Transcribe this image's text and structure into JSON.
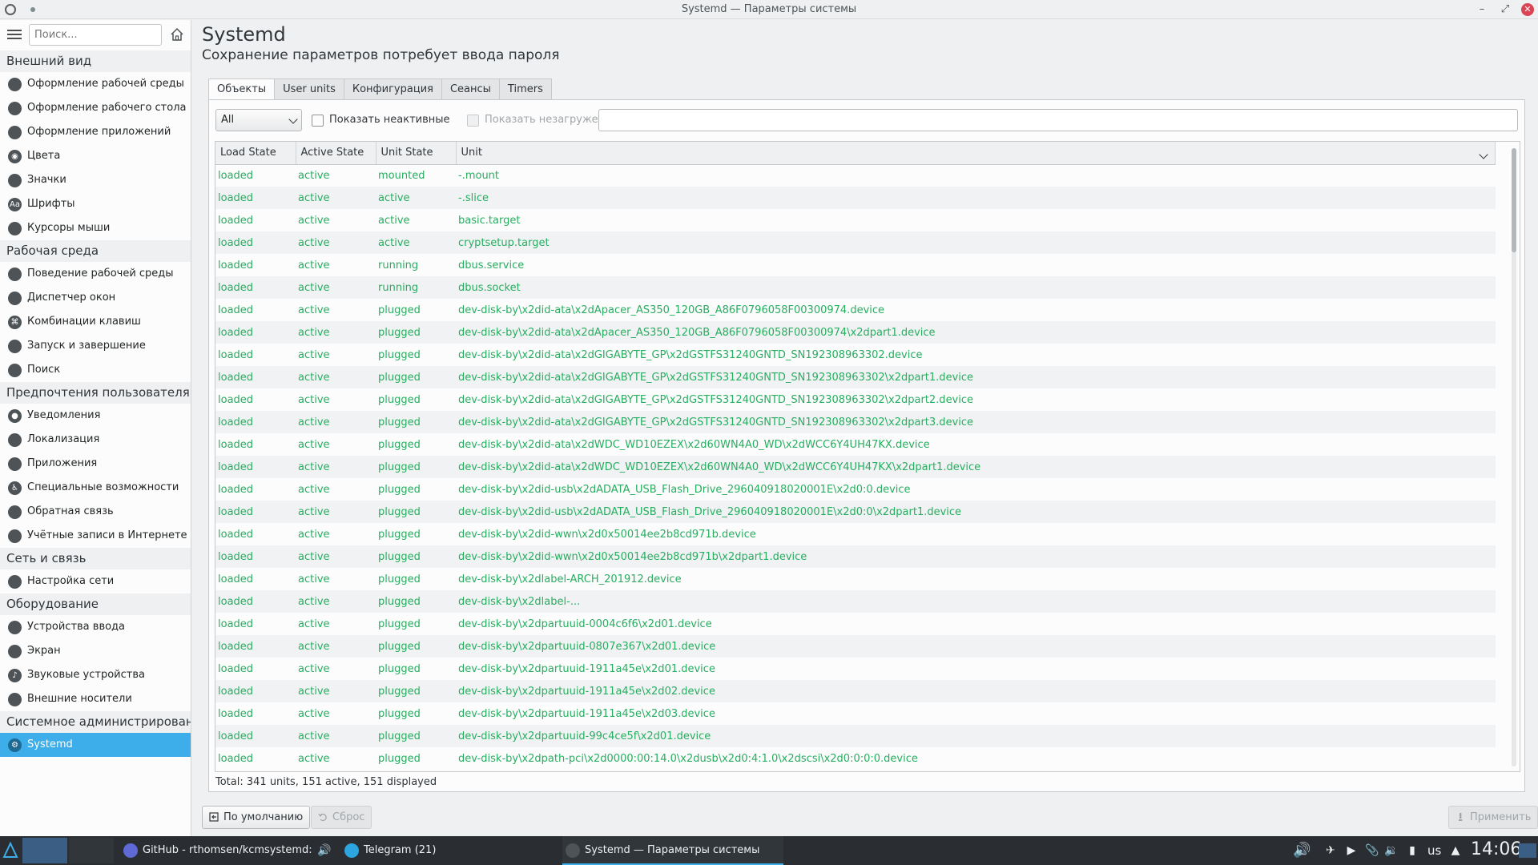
{
  "window": {
    "title": "Systemd — Параметры системы"
  },
  "sidebar": {
    "search_placeholder": "Поиск...",
    "categories": [
      {
        "title": "Внешний вид",
        "items": [
          {
            "label": "Оформление рабочей среды",
            "icon": "workspace-theme-icon"
          },
          {
            "label": "Оформление рабочего стола",
            "icon": "desktop-theme-icon"
          },
          {
            "label": "Оформление приложений",
            "icon": "application-style-icon"
          },
          {
            "label": "Цвета",
            "icon": "colors-icon"
          },
          {
            "label": "Значки",
            "icon": "icons-icon"
          },
          {
            "label": "Шрифты",
            "icon": "fonts-icon"
          },
          {
            "label": "Курсоры мыши",
            "icon": "cursor-icon"
          }
        ]
      },
      {
        "title": "Рабочая среда",
        "items": [
          {
            "label": "Поведение рабочей среды",
            "icon": "workspace-behavior-icon"
          },
          {
            "label": "Диспетчер окон",
            "icon": "window-manager-icon"
          },
          {
            "label": "Комбинации клавиш",
            "icon": "shortcuts-icon"
          },
          {
            "label": "Запуск и завершение",
            "icon": "startup-icon"
          },
          {
            "label": "Поиск",
            "icon": "search-icon"
          }
        ]
      },
      {
        "title": "Предпочтения пользователя",
        "items": [
          {
            "label": "Уведомления",
            "icon": "notifications-icon"
          },
          {
            "label": "Локализация",
            "icon": "locale-icon"
          },
          {
            "label": "Приложения",
            "icon": "applications-icon"
          },
          {
            "label": "Специальные возможности",
            "icon": "accessibility-icon"
          },
          {
            "label": "Обратная связь",
            "icon": "feedback-icon"
          },
          {
            "label": "Учётные записи в Интернете",
            "icon": "online-accounts-icon"
          }
        ]
      },
      {
        "title": "Сеть и связь",
        "items": [
          {
            "label": "Настройка сети",
            "icon": "network-icon"
          }
        ]
      },
      {
        "title": "Оборудование",
        "items": [
          {
            "label": "Устройства ввода",
            "icon": "input-devices-icon"
          },
          {
            "label": "Экран",
            "icon": "display-icon"
          },
          {
            "label": "Звуковые устройства",
            "icon": "audio-icon"
          },
          {
            "label": "Внешние носители",
            "icon": "removable-storage-icon"
          }
        ]
      },
      {
        "title": "Системное администрировани",
        "items": [
          {
            "label": "Systemd",
            "icon": "systemd-icon",
            "selected": true
          }
        ]
      }
    ]
  },
  "main": {
    "title": "Systemd",
    "subtitle": "Сохранение параметров потребует ввода пароля",
    "tabs": [
      "Объекты",
      "User units",
      "Конфигурация",
      "Сеансы",
      "Timers"
    ],
    "active_tab": 0,
    "filter_combo": "All",
    "show_inactive_label": "Показать неактивные",
    "show_unloaded_label": "Показать незагруженные",
    "columns": [
      "Load State",
      "Active State",
      "Unit State",
      "Unit"
    ],
    "rows": [
      [
        "loaded",
        "active",
        "mounted",
        "-.mount"
      ],
      [
        "loaded",
        "active",
        "active",
        "-.slice"
      ],
      [
        "loaded",
        "active",
        "active",
        "basic.target"
      ],
      [
        "loaded",
        "active",
        "active",
        "cryptsetup.target"
      ],
      [
        "loaded",
        "active",
        "running",
        "dbus.service"
      ],
      [
        "loaded",
        "active",
        "running",
        "dbus.socket"
      ],
      [
        "loaded",
        "active",
        "plugged",
        "dev-disk-by\\x2did-ata\\x2dApacer_AS350_120GB_A86F0796058F00300974.device"
      ],
      [
        "loaded",
        "active",
        "plugged",
        "dev-disk-by\\x2did-ata\\x2dApacer_AS350_120GB_A86F0796058F00300974\\x2dpart1.device"
      ],
      [
        "loaded",
        "active",
        "plugged",
        "dev-disk-by\\x2did-ata\\x2dGIGABYTE_GP\\x2dGSTFS31240GNTD_SN192308963302.device"
      ],
      [
        "loaded",
        "active",
        "plugged",
        "dev-disk-by\\x2did-ata\\x2dGIGABYTE_GP\\x2dGSTFS31240GNTD_SN192308963302\\x2dpart1.device"
      ],
      [
        "loaded",
        "active",
        "plugged",
        "dev-disk-by\\x2did-ata\\x2dGIGABYTE_GP\\x2dGSTFS31240GNTD_SN192308963302\\x2dpart2.device"
      ],
      [
        "loaded",
        "active",
        "plugged",
        "dev-disk-by\\x2did-ata\\x2dGIGABYTE_GP\\x2dGSTFS31240GNTD_SN192308963302\\x2dpart3.device"
      ],
      [
        "loaded",
        "active",
        "plugged",
        "dev-disk-by\\x2did-ata\\x2dWDC_WD10EZEX\\x2d60WN4A0_WD\\x2dWCC6Y4UH47KX.device"
      ],
      [
        "loaded",
        "active",
        "plugged",
        "dev-disk-by\\x2did-ata\\x2dWDC_WD10EZEX\\x2d60WN4A0_WD\\x2dWCC6Y4UH47KX\\x2dpart1.device"
      ],
      [
        "loaded",
        "active",
        "plugged",
        "dev-disk-by\\x2did-usb\\x2dADATA_USB_Flash_Drive_296040918020001E\\x2d0:0.device"
      ],
      [
        "loaded",
        "active",
        "plugged",
        "dev-disk-by\\x2did-usb\\x2dADATA_USB_Flash_Drive_296040918020001E\\x2d0:0\\x2dpart1.device"
      ],
      [
        "loaded",
        "active",
        "plugged",
        "dev-disk-by\\x2did-wwn\\x2d0x50014ee2b8cd971b.device"
      ],
      [
        "loaded",
        "active",
        "plugged",
        "dev-disk-by\\x2did-wwn\\x2d0x50014ee2b8cd971b\\x2dpart1.device"
      ],
      [
        "loaded",
        "active",
        "plugged",
        "dev-disk-by\\x2dlabel-ARCH_201912.device"
      ],
      [
        "loaded",
        "active",
        "plugged",
        "dev-disk-by\\x2dlabel-..."
      ],
      [
        "loaded",
        "active",
        "plugged",
        "dev-disk-by\\x2dpartuuid-0004c6f6\\x2d01.device"
      ],
      [
        "loaded",
        "active",
        "plugged",
        "dev-disk-by\\x2dpartuuid-0807e367\\x2d01.device"
      ],
      [
        "loaded",
        "active",
        "plugged",
        "dev-disk-by\\x2dpartuuid-1911a45e\\x2d01.device"
      ],
      [
        "loaded",
        "active",
        "plugged",
        "dev-disk-by\\x2dpartuuid-1911a45e\\x2d02.device"
      ],
      [
        "loaded",
        "active",
        "plugged",
        "dev-disk-by\\x2dpartuuid-1911a45e\\x2d03.device"
      ],
      [
        "loaded",
        "active",
        "plugged",
        "dev-disk-by\\x2dpartuuid-99c4ce5f\\x2d01.device"
      ],
      [
        "loaded",
        "active",
        "plugged",
        "dev-disk-by\\x2dpath-pci\\x2d0000:00:14.0\\x2dusb\\x2d0:4:1.0\\x2dscsi\\x2d0:0:0:0.device"
      ]
    ],
    "total": "Total: 341 units, 151 active, 151 displayed",
    "defaults_button": "По умолчанию",
    "reset_button": "Сброс",
    "apply_button": "Применить"
  },
  "taskbar": {
    "tasks": [
      {
        "label": "GitHub - rthomsen/kcmsystemd: A...",
        "icon": "browser-icon"
      },
      {
        "label": "Telegram (21)",
        "icon": "telegram-icon"
      },
      {
        "label": "Systemd — Параметры системы",
        "icon": "settings-icon",
        "active": true
      }
    ],
    "keyboard_layout": "us",
    "clock": "14:06"
  },
  "colors": {
    "accent": "#3daee9",
    "unit_text": "#27ae60",
    "close": "#da4453"
  }
}
